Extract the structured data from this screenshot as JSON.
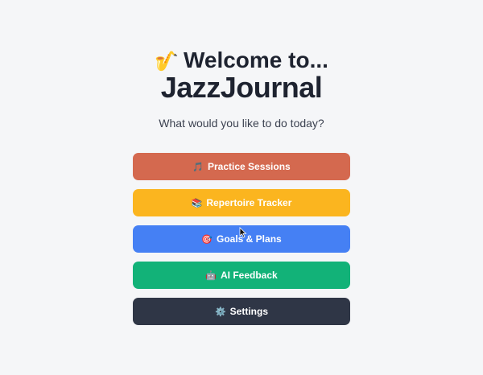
{
  "header": {
    "sax_icon": "🎷",
    "welcome": "Welcome to...",
    "app_name": "JazzJournal",
    "prompt": "What would you like to do today?"
  },
  "menu": {
    "items": [
      {
        "icon": "🎵",
        "label": "Practice Sessions",
        "color": "#d4694f"
      },
      {
        "icon": "📚",
        "label": "Repertoire Tracker",
        "color": "#fbb51f"
      },
      {
        "icon": "🎯",
        "label": "Goals & Plans",
        "color": "#4580f4"
      },
      {
        "icon": "🤖",
        "label": "AI Feedback",
        "color": "#12b278"
      },
      {
        "icon": "⚙️",
        "label": "Settings",
        "color": "#2f3646"
      }
    ]
  }
}
